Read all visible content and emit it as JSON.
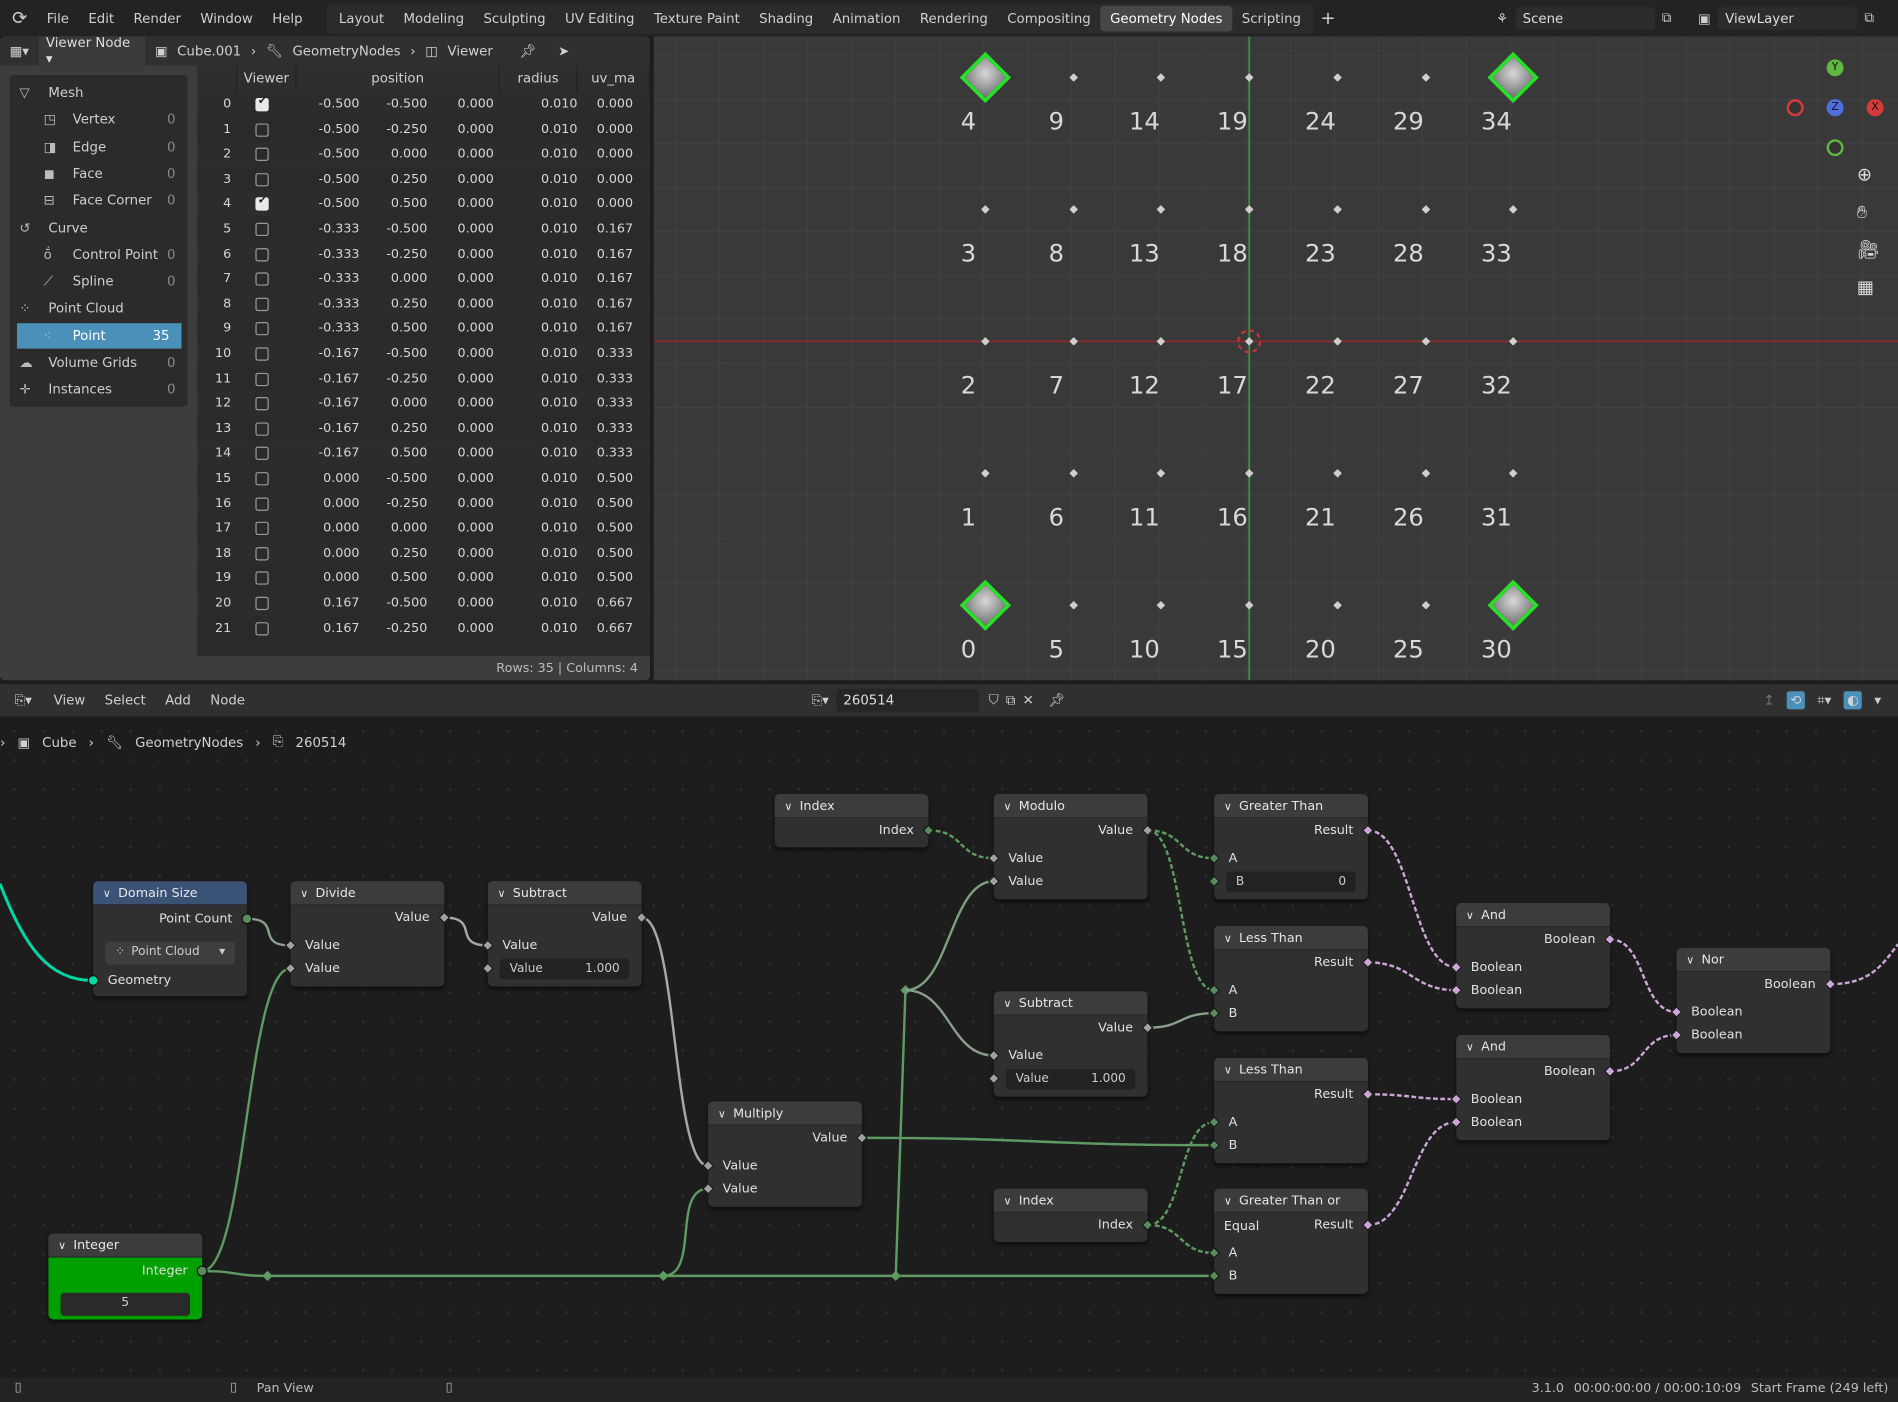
{
  "topbar": {
    "menus": [
      "File",
      "Edit",
      "Render",
      "Window",
      "Help"
    ],
    "workspaces": [
      "Layout",
      "Modeling",
      "Sculpting",
      "UV Editing",
      "Texture Paint",
      "Shading",
      "Animation",
      "Rendering",
      "Compositing",
      "Geometry Nodes",
      "Scripting"
    ],
    "active_workspace": "Geometry Nodes",
    "add_tab": "+",
    "scene": "Scene",
    "view_layer": "ViewLayer"
  },
  "spreadsheet": {
    "header": {
      "object_eval_state": "Viewer Node",
      "object": "Cube.001",
      "modifier": "GeometryNodes",
      "node": "Viewer"
    },
    "domains": [
      {
        "label": "Mesh",
        "count": "",
        "group": true,
        "icon": "mesh-icon"
      },
      {
        "label": "Vertex",
        "count": "0",
        "icon": "vertex-icon"
      },
      {
        "label": "Edge",
        "count": "0",
        "icon": "edge-icon"
      },
      {
        "label": "Face",
        "count": "0",
        "icon": "face-icon"
      },
      {
        "label": "Face Corner",
        "count": "0",
        "icon": "face-corner-icon"
      },
      {
        "label": "Curve",
        "count": "",
        "group": true,
        "icon": "curve-icon"
      },
      {
        "label": "Control Point",
        "count": "0",
        "icon": "control-point-icon"
      },
      {
        "label": "Spline",
        "count": "0",
        "icon": "spline-icon"
      },
      {
        "label": "Point Cloud",
        "count": "",
        "group": true,
        "icon": "point-cloud-icon"
      },
      {
        "label": "Point",
        "count": "35",
        "selected": true,
        "icon": "point-icon"
      },
      {
        "label": "Volume Grids",
        "count": "0",
        "group": true,
        "icon": "volume-icon"
      },
      {
        "label": "Instances",
        "count": "0",
        "group": true,
        "icon": "instances-icon"
      }
    ],
    "columns": [
      "Viewer",
      "position",
      "radius",
      "uv_ma"
    ],
    "rows": [
      {
        "i": "0",
        "v": true,
        "p": [
          "-0.500",
          "-0.500",
          "0.000"
        ],
        "r": "0.010",
        "uv": "0.000"
      },
      {
        "i": "1",
        "v": false,
        "p": [
          "-0.500",
          "-0.250",
          "0.000"
        ],
        "r": "0.010",
        "uv": "0.000"
      },
      {
        "i": "2",
        "v": false,
        "p": [
          "-0.500",
          "0.000",
          "0.000"
        ],
        "r": "0.010",
        "uv": "0.000"
      },
      {
        "i": "3",
        "v": false,
        "p": [
          "-0.500",
          "0.250",
          "0.000"
        ],
        "r": "0.010",
        "uv": "0.000"
      },
      {
        "i": "4",
        "v": true,
        "p": [
          "-0.500",
          "0.500",
          "0.000"
        ],
        "r": "0.010",
        "uv": "0.000"
      },
      {
        "i": "5",
        "v": false,
        "p": [
          "-0.333",
          "-0.500",
          "0.000"
        ],
        "r": "0.010",
        "uv": "0.167"
      },
      {
        "i": "6",
        "v": false,
        "p": [
          "-0.333",
          "-0.250",
          "0.000"
        ],
        "r": "0.010",
        "uv": "0.167"
      },
      {
        "i": "7",
        "v": false,
        "p": [
          "-0.333",
          "0.000",
          "0.000"
        ],
        "r": "0.010",
        "uv": "0.167"
      },
      {
        "i": "8",
        "v": false,
        "p": [
          "-0.333",
          "0.250",
          "0.000"
        ],
        "r": "0.010",
        "uv": "0.167"
      },
      {
        "i": "9",
        "v": false,
        "p": [
          "-0.333",
          "0.500",
          "0.000"
        ],
        "r": "0.010",
        "uv": "0.167"
      },
      {
        "i": "10",
        "v": false,
        "p": [
          "-0.167",
          "-0.500",
          "0.000"
        ],
        "r": "0.010",
        "uv": "0.333"
      },
      {
        "i": "11",
        "v": false,
        "p": [
          "-0.167",
          "-0.250",
          "0.000"
        ],
        "r": "0.010",
        "uv": "0.333"
      },
      {
        "i": "12",
        "v": false,
        "p": [
          "-0.167",
          "0.000",
          "0.000"
        ],
        "r": "0.010",
        "uv": "0.333"
      },
      {
        "i": "13",
        "v": false,
        "p": [
          "-0.167",
          "0.250",
          "0.000"
        ],
        "r": "0.010",
        "uv": "0.333"
      },
      {
        "i": "14",
        "v": false,
        "p": [
          "-0.167",
          "0.500",
          "0.000"
        ],
        "r": "0.010",
        "uv": "0.333"
      },
      {
        "i": "15",
        "v": false,
        "p": [
          "0.000",
          "-0.500",
          "0.000"
        ],
        "r": "0.010",
        "uv": "0.500"
      },
      {
        "i": "16",
        "v": false,
        "p": [
          "0.000",
          "-0.250",
          "0.000"
        ],
        "r": "0.010",
        "uv": "0.500"
      },
      {
        "i": "17",
        "v": false,
        "p": [
          "0.000",
          "0.000",
          "0.000"
        ],
        "r": "0.010",
        "uv": "0.500"
      },
      {
        "i": "18",
        "v": false,
        "p": [
          "0.000",
          "0.250",
          "0.000"
        ],
        "r": "0.010",
        "uv": "0.500"
      },
      {
        "i": "19",
        "v": false,
        "p": [
          "0.000",
          "0.500",
          "0.000"
        ],
        "r": "0.010",
        "uv": "0.500"
      },
      {
        "i": "20",
        "v": false,
        "p": [
          "0.167",
          "-0.500",
          "0.000"
        ],
        "r": "0.010",
        "uv": "0.667"
      },
      {
        "i": "21",
        "v": false,
        "p": [
          "0.167",
          "-0.250",
          "0.000"
        ],
        "r": "0.010",
        "uv": "0.667"
      }
    ],
    "footer": "Rows: 35   |   Columns: 4"
  },
  "viewport": {
    "point_labels": [
      "0",
      "1",
      "2",
      "3",
      "4",
      "5",
      "6",
      "7",
      "8",
      "9",
      "10",
      "11",
      "12",
      "13",
      "14",
      "15",
      "16",
      "17",
      "18",
      "19",
      "20",
      "21",
      "22",
      "23",
      "24",
      "25",
      "26",
      "27",
      "28",
      "29",
      "30",
      "31",
      "32",
      "33",
      "34"
    ],
    "highlighted": [
      "0",
      "4",
      "30",
      "34"
    ],
    "gizmo": {
      "x": "X",
      "y": "Y",
      "z": "Z"
    },
    "highlight_color": "#28e028"
  },
  "node_editor": {
    "menus": [
      "View",
      "Select",
      "Add",
      "Node"
    ],
    "node_group": "260514",
    "breadcrumb": [
      "Cube",
      "GeometryNodes",
      "260514"
    ],
    "nodes": [
      {
        "id": "index1",
        "title": "Index",
        "rows": [
          {
            "t": "out",
            "label": "Index",
            "s": "int"
          }
        ]
      },
      {
        "id": "modulo",
        "title": "Modulo",
        "rows": [
          {
            "t": "out",
            "label": "Value",
            "s": "float"
          },
          {
            "t": "in",
            "label": "Value",
            "s": "float"
          },
          {
            "t": "in",
            "label": "Value",
            "s": "float"
          }
        ]
      },
      {
        "id": "gt",
        "title": "Greater Than",
        "rows": [
          {
            "t": "out",
            "label": "Result",
            "s": "bool"
          },
          {
            "t": "in",
            "label": "A",
            "s": "int"
          },
          {
            "t": "field",
            "label": "B",
            "value": "0",
            "s": "int"
          }
        ]
      },
      {
        "id": "domain",
        "title": "Domain Size",
        "header": "#3b5277",
        "rows": [
          {
            "t": "out",
            "label": "Point Count",
            "s": "int"
          },
          {
            "t": "dropdown",
            "label": "Point Cloud"
          },
          {
            "t": "in",
            "label": "Geometry",
            "s": "geo"
          }
        ]
      },
      {
        "id": "divide",
        "title": "Divide",
        "rows": [
          {
            "t": "out",
            "label": "Value",
            "s": "float"
          },
          {
            "t": "in",
            "label": "Value",
            "s": "float"
          },
          {
            "t": "in",
            "label": "Value",
            "s": "float"
          }
        ]
      },
      {
        "id": "sub1",
        "title": "Subtract",
        "rows": [
          {
            "t": "out",
            "label": "Value",
            "s": "float"
          },
          {
            "t": "in",
            "label": "Value",
            "s": "float"
          },
          {
            "t": "field",
            "label": "Value",
            "value": "1.000",
            "s": "float"
          }
        ]
      },
      {
        "id": "lt1",
        "title": "Less Than",
        "rows": [
          {
            "t": "out",
            "label": "Result",
            "s": "bool"
          },
          {
            "t": "in",
            "label": "A",
            "s": "int"
          },
          {
            "t": "in",
            "label": "B",
            "s": "int"
          }
        ]
      },
      {
        "id": "and1",
        "title": "And",
        "rows": [
          {
            "t": "out",
            "label": "Boolean",
            "s": "bool"
          },
          {
            "t": "in",
            "label": "Boolean",
            "s": "bool"
          },
          {
            "t": "in",
            "label": "Boolean",
            "s": "bool"
          }
        ]
      },
      {
        "id": "nor",
        "title": "Nor",
        "rows": [
          {
            "t": "out",
            "label": "Boolean",
            "s": "bool"
          },
          {
            "t": "in",
            "label": "Boolean",
            "s": "bool"
          },
          {
            "t": "in",
            "label": "Boolean",
            "s": "bool"
          }
        ]
      },
      {
        "id": "sub2",
        "title": "Subtract",
        "rows": [
          {
            "t": "out",
            "label": "Value",
            "s": "float"
          },
          {
            "t": "in",
            "label": "Value",
            "s": "float"
          },
          {
            "t": "field",
            "label": "Value",
            "value": "1.000",
            "s": "float"
          }
        ]
      },
      {
        "id": "and2",
        "title": "And",
        "rows": [
          {
            "t": "out",
            "label": "Boolean",
            "s": "bool"
          },
          {
            "t": "in",
            "label": "Boolean",
            "s": "bool"
          },
          {
            "t": "in",
            "label": "Boolean",
            "s": "bool"
          }
        ]
      },
      {
        "id": "lt2",
        "title": "Less Than",
        "rows": [
          {
            "t": "out",
            "label": "Result",
            "s": "bool"
          },
          {
            "t": "in",
            "label": "A",
            "s": "int"
          },
          {
            "t": "in",
            "label": "B",
            "s": "int"
          }
        ]
      },
      {
        "id": "multiply",
        "title": "Multiply",
        "rows": [
          {
            "t": "out",
            "label": "Value",
            "s": "float"
          },
          {
            "t": "in",
            "label": "Value",
            "s": "float"
          },
          {
            "t": "in",
            "label": "Value",
            "s": "float"
          }
        ]
      },
      {
        "id": "index2",
        "title": "Index",
        "rows": [
          {
            "t": "out",
            "label": "Index",
            "s": "int"
          }
        ]
      },
      {
        "id": "gte",
        "title": "Greater Than or Equal",
        "rows": [
          {
            "t": "out",
            "label": "Result",
            "s": "bool"
          },
          {
            "t": "in",
            "label": "A",
            "s": "int"
          },
          {
            "t": "in",
            "label": "B",
            "s": "int"
          }
        ]
      },
      {
        "id": "integer",
        "title": "Integer",
        "body": "#00a000",
        "rows": [
          {
            "t": "out",
            "label": "Integer",
            "s": "int"
          },
          {
            "t": "intfield",
            "value": "5"
          }
        ]
      }
    ],
    "socket_colors": {
      "float": "#a1a1a1",
      "int": "#598c5c",
      "bool": "#cca6d6",
      "geo": "#00d6a3"
    }
  },
  "status": {
    "action": "Pan View",
    "version": "3.1.0",
    "time": "00:00:00:00 / 00:00:10:09",
    "frame": "Start Frame (249 left)"
  }
}
